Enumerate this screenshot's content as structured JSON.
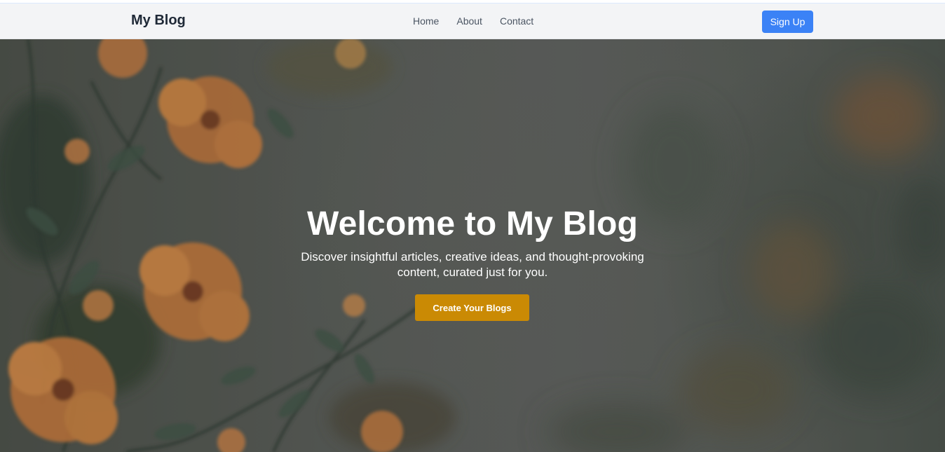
{
  "navbar": {
    "brand": "My Blog",
    "links": [
      "Home",
      "About",
      "Contact"
    ],
    "signup_label": "Sign Up"
  },
  "hero": {
    "title": "Welcome to My Blog",
    "subtitle": "Discover insightful articles, creative ideas, and thought-provoking content, curated just for you.",
    "cta_label": "Create Your Blogs",
    "background_image": "blurred orange flowers on green-grey background"
  },
  "colors": {
    "primary_button": "#3b82f6",
    "cta_button": "#ca8a04",
    "navbar_bg": "#f3f4f6",
    "brand_text": "#1f2937"
  }
}
